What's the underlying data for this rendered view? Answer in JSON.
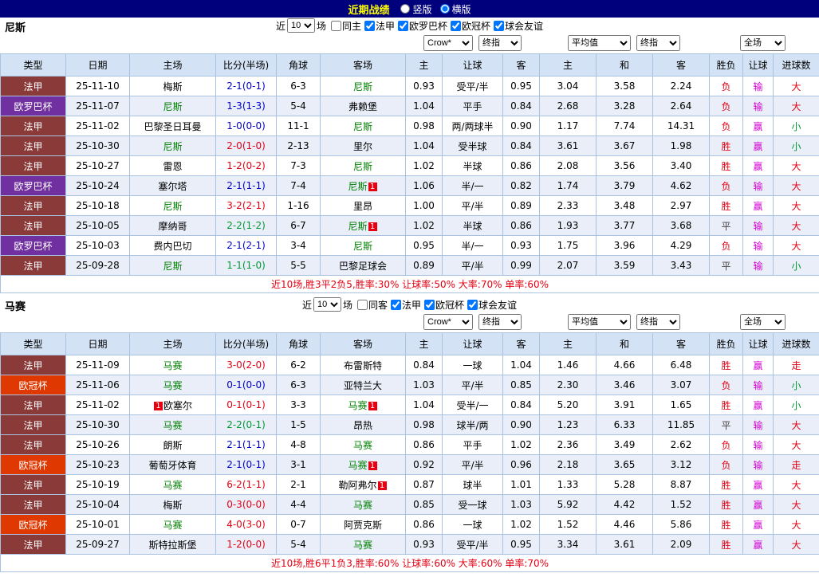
{
  "topbar": {
    "title": "近期战绩",
    "radios": [
      {
        "label": "竖版",
        "selected": false
      },
      {
        "label": "横版",
        "selected": true
      }
    ]
  },
  "ui": {
    "near_label": "近",
    "games_label": "场"
  },
  "table": {
    "headers": [
      "类型",
      "日期",
      "主场",
      "比分(半场)",
      "角球",
      "客场",
      "主",
      "让球",
      "客",
      "主",
      "和",
      "客",
      "胜负",
      "让球",
      "进球数"
    ]
  },
  "colors": {
    "topbar_bg": "#00007d",
    "title_color": "#ffff00",
    "focus_team": "#008000",
    "leagues": {
      "法甲": "#8b3a3a",
      "欧罗巴杯": "#7030a0",
      "欧冠杯": "#df3800"
    },
    "score": {
      "win": "#e60012",
      "draw": "#009933",
      "loss": "#0000cc"
    },
    "result": {
      "胜": "#e60012",
      "平": "#444444",
      "负": "#e60012"
    },
    "handicap_result": "#d400d4",
    "goals": {
      "大": "#e60012",
      "小": "#009933",
      "走": "#e60012"
    }
  },
  "sections": [
    {
      "team": "尼斯",
      "filter": {
        "count": "10",
        "checkboxes": [
          {
            "label": "同主",
            "checked": false
          },
          {
            "label": "法甲",
            "checked": true
          },
          {
            "label": "欧罗巴杯",
            "checked": true
          },
          {
            "label": "欧冠杯",
            "checked": true
          },
          {
            "label": "球会友谊",
            "checked": true
          }
        ]
      },
      "selects": {
        "source": "Crow*",
        "source_time": "终指",
        "europe": "平均值",
        "europe_time": "终指",
        "scope": "全场"
      },
      "rows": [
        {
          "league": "法甲",
          "date": "25-11-10",
          "home": {
            "name": "梅斯"
          },
          "score": "2-1(0-1)",
          "score_class": "loss",
          "corner": "6-3",
          "away": {
            "name": "尼斯",
            "focus": true
          },
          "ah": [
            "0.93",
            "受平/半",
            "0.95"
          ],
          "eu": [
            "3.04",
            "3.58",
            "2.24"
          ],
          "result": "负",
          "handicap": "输",
          "goals": "大"
        },
        {
          "league": "欧罗巴杯",
          "date": "25-11-07",
          "home": {
            "name": "尼斯",
            "focus": true
          },
          "score": "1-3(1-3)",
          "score_class": "loss",
          "corner": "5-4",
          "away": {
            "name": "弗赖堡"
          },
          "ah": [
            "1.04",
            "平手",
            "0.84"
          ],
          "eu": [
            "2.68",
            "3.28",
            "2.64"
          ],
          "result": "负",
          "handicap": "输",
          "goals": "大"
        },
        {
          "league": "法甲",
          "date": "25-11-02",
          "home": {
            "name": "巴黎圣日耳曼"
          },
          "score": "1-0(0-0)",
          "score_class": "loss",
          "corner": "11-1",
          "away": {
            "name": "尼斯",
            "focus": true
          },
          "ah": [
            "0.98",
            "两/两球半",
            "0.90"
          ],
          "eu": [
            "1.17",
            "7.74",
            "14.31"
          ],
          "result": "负",
          "handicap": "赢",
          "goals": "小"
        },
        {
          "league": "法甲",
          "date": "25-10-30",
          "home": {
            "name": "尼斯",
            "focus": true
          },
          "score": "2-0(1-0)",
          "score_class": "win",
          "corner": "2-13",
          "away": {
            "name": "里尔"
          },
          "ah": [
            "1.04",
            "受半球",
            "0.84"
          ],
          "eu": [
            "3.61",
            "3.67",
            "1.98"
          ],
          "result": "胜",
          "handicap": "赢",
          "goals": "小"
        },
        {
          "league": "法甲",
          "date": "25-10-27",
          "home": {
            "name": "雷恩"
          },
          "score": "1-2(0-2)",
          "score_class": "win",
          "corner": "7-3",
          "away": {
            "name": "尼斯",
            "focus": true
          },
          "ah": [
            "1.02",
            "半球",
            "0.86"
          ],
          "eu": [
            "2.08",
            "3.56",
            "3.40"
          ],
          "result": "胜",
          "handicap": "赢",
          "goals": "大"
        },
        {
          "league": "欧罗巴杯",
          "date": "25-10-24",
          "home": {
            "name": "塞尔塔"
          },
          "score": "2-1(1-1)",
          "score_class": "loss",
          "corner": "7-4",
          "away": {
            "name": "尼斯",
            "focus": true,
            "badge": "1"
          },
          "ah": [
            "1.06",
            "半/一",
            "0.82"
          ],
          "eu": [
            "1.74",
            "3.79",
            "4.62"
          ],
          "result": "负",
          "handicap": "输",
          "goals": "大"
        },
        {
          "league": "法甲",
          "date": "25-10-18",
          "home": {
            "name": "尼斯",
            "focus": true
          },
          "score": "3-2(2-1)",
          "score_class": "win",
          "corner": "1-16",
          "away": {
            "name": "里昂"
          },
          "ah": [
            "1.00",
            "平/半",
            "0.89"
          ],
          "eu": [
            "2.33",
            "3.48",
            "2.97"
          ],
          "result": "胜",
          "handicap": "赢",
          "goals": "大"
        },
        {
          "league": "法甲",
          "date": "25-10-05",
          "home": {
            "name": "摩纳哥"
          },
          "score": "2-2(1-2)",
          "score_class": "draw",
          "corner": "6-7",
          "away": {
            "name": "尼斯",
            "focus": true,
            "badge": "1"
          },
          "ah": [
            "1.02",
            "半球",
            "0.86"
          ],
          "eu": [
            "1.93",
            "3.77",
            "3.68"
          ],
          "result": "平",
          "handicap": "输",
          "goals": "大"
        },
        {
          "league": "欧罗巴杯",
          "date": "25-10-03",
          "home": {
            "name": "费内巴切"
          },
          "score": "2-1(2-1)",
          "score_class": "loss",
          "corner": "3-4",
          "away": {
            "name": "尼斯",
            "focus": true
          },
          "ah": [
            "0.95",
            "半/一",
            "0.93"
          ],
          "eu": [
            "1.75",
            "3.96",
            "4.29"
          ],
          "result": "负",
          "handicap": "输",
          "goals": "大"
        },
        {
          "league": "法甲",
          "date": "25-09-28",
          "home": {
            "name": "尼斯",
            "focus": true
          },
          "score": "1-1(1-0)",
          "score_class": "draw",
          "corner": "5-5",
          "away": {
            "name": "巴黎足球会"
          },
          "ah": [
            "0.89",
            "平/半",
            "0.99"
          ],
          "eu": [
            "2.07",
            "3.59",
            "3.43"
          ],
          "result": "平",
          "handicap": "输",
          "goals": "小"
        }
      ],
      "summary": "近10场,胜3平2负5,胜率:30% 让球率:50% 大率:70% 单率:60%"
    },
    {
      "team": "马赛",
      "filter": {
        "count": "10",
        "checkboxes": [
          {
            "label": "同客",
            "checked": false
          },
          {
            "label": "法甲",
            "checked": true
          },
          {
            "label": "欧冠杯",
            "checked": true
          },
          {
            "label": "球会友谊",
            "checked": true
          }
        ]
      },
      "selects": {
        "source": "Crow*",
        "source_time": "终指",
        "europe": "平均值",
        "europe_time": "终指",
        "scope": "全场"
      },
      "rows": [
        {
          "league": "法甲",
          "date": "25-11-09",
          "home": {
            "name": "马赛",
            "focus": true
          },
          "score": "3-0(2-0)",
          "score_class": "win",
          "corner": "6-2",
          "away": {
            "name": "布雷斯特"
          },
          "ah": [
            "0.84",
            "一球",
            "1.04"
          ],
          "eu": [
            "1.46",
            "4.66",
            "6.48"
          ],
          "result": "胜",
          "handicap": "赢",
          "goals": "走"
        },
        {
          "league": "欧冠杯",
          "date": "25-11-06",
          "home": {
            "name": "马赛",
            "focus": true
          },
          "score": "0-1(0-0)",
          "score_class": "loss",
          "corner": "6-3",
          "away": {
            "name": "亚特兰大"
          },
          "ah": [
            "1.03",
            "平/半",
            "0.85"
          ],
          "eu": [
            "2.30",
            "3.46",
            "3.07"
          ],
          "result": "负",
          "handicap": "输",
          "goals": "小"
        },
        {
          "league": "法甲",
          "date": "25-11-02",
          "home": {
            "name": "欧塞尔",
            "badge_left": "1"
          },
          "score": "0-1(0-1)",
          "score_class": "win",
          "corner": "3-3",
          "away": {
            "name": "马赛",
            "focus": true,
            "badge": "1"
          },
          "ah": [
            "1.04",
            "受半/一",
            "0.84"
          ],
          "eu": [
            "5.20",
            "3.91",
            "1.65"
          ],
          "result": "胜",
          "handicap": "赢",
          "goals": "小"
        },
        {
          "league": "法甲",
          "date": "25-10-30",
          "home": {
            "name": "马赛",
            "focus": true
          },
          "score": "2-2(0-1)",
          "score_class": "draw",
          "corner": "1-5",
          "away": {
            "name": "昂热"
          },
          "ah": [
            "0.98",
            "球半/两",
            "0.90"
          ],
          "eu": [
            "1.23",
            "6.33",
            "11.85"
          ],
          "result": "平",
          "handicap": "输",
          "goals": "大"
        },
        {
          "league": "法甲",
          "date": "25-10-26",
          "home": {
            "name": "朗斯"
          },
          "score": "2-1(1-1)",
          "score_class": "loss",
          "corner": "4-8",
          "away": {
            "name": "马赛",
            "focus": true
          },
          "ah": [
            "0.86",
            "平手",
            "1.02"
          ],
          "eu": [
            "2.36",
            "3.49",
            "2.62"
          ],
          "result": "负",
          "handicap": "输",
          "goals": "大"
        },
        {
          "league": "欧冠杯",
          "date": "25-10-23",
          "home": {
            "name": "葡萄牙体育"
          },
          "score": "2-1(0-1)",
          "score_class": "loss",
          "corner": "3-1",
          "away": {
            "name": "马赛",
            "focus": true,
            "badge": "1"
          },
          "ah": [
            "0.92",
            "平/半",
            "0.96"
          ],
          "eu": [
            "2.18",
            "3.65",
            "3.12"
          ],
          "result": "负",
          "handicap": "输",
          "goals": "走"
        },
        {
          "league": "法甲",
          "date": "25-10-19",
          "home": {
            "name": "马赛",
            "focus": true
          },
          "score": "6-2(1-1)",
          "score_class": "win",
          "corner": "2-1",
          "away": {
            "name": "勒阿弗尔",
            "badge": "1"
          },
          "ah": [
            "0.87",
            "球半",
            "1.01"
          ],
          "eu": [
            "1.33",
            "5.28",
            "8.87"
          ],
          "result": "胜",
          "handicap": "赢",
          "goals": "大"
        },
        {
          "league": "法甲",
          "date": "25-10-04",
          "home": {
            "name": "梅斯"
          },
          "score": "0-3(0-0)",
          "score_class": "win",
          "corner": "4-4",
          "away": {
            "name": "马赛",
            "focus": true
          },
          "ah": [
            "0.85",
            "受一球",
            "1.03"
          ],
          "eu": [
            "5.92",
            "4.42",
            "1.52"
          ],
          "result": "胜",
          "handicap": "赢",
          "goals": "大"
        },
        {
          "league": "欧冠杯",
          "date": "25-10-01",
          "home": {
            "name": "马赛",
            "focus": true
          },
          "score": "4-0(3-0)",
          "score_class": "win",
          "corner": "0-7",
          "away": {
            "name": "阿贾克斯"
          },
          "ah": [
            "0.86",
            "一球",
            "1.02"
          ],
          "eu": [
            "1.52",
            "4.46",
            "5.86"
          ],
          "result": "胜",
          "handicap": "赢",
          "goals": "大"
        },
        {
          "league": "法甲",
          "date": "25-09-27",
          "home": {
            "name": "斯特拉斯堡"
          },
          "score": "1-2(0-0)",
          "score_class": "win",
          "corner": "5-4",
          "away": {
            "name": "马赛",
            "focus": true
          },
          "ah": [
            "0.93",
            "受平/半",
            "0.95"
          ],
          "eu": [
            "3.34",
            "3.61",
            "2.09"
          ],
          "result": "胜",
          "handicap": "赢",
          "goals": "大"
        }
      ],
      "summary": "近10场,胜6平1负3,胜率:60% 让球率:60% 大率:60% 单率:70%"
    }
  ]
}
